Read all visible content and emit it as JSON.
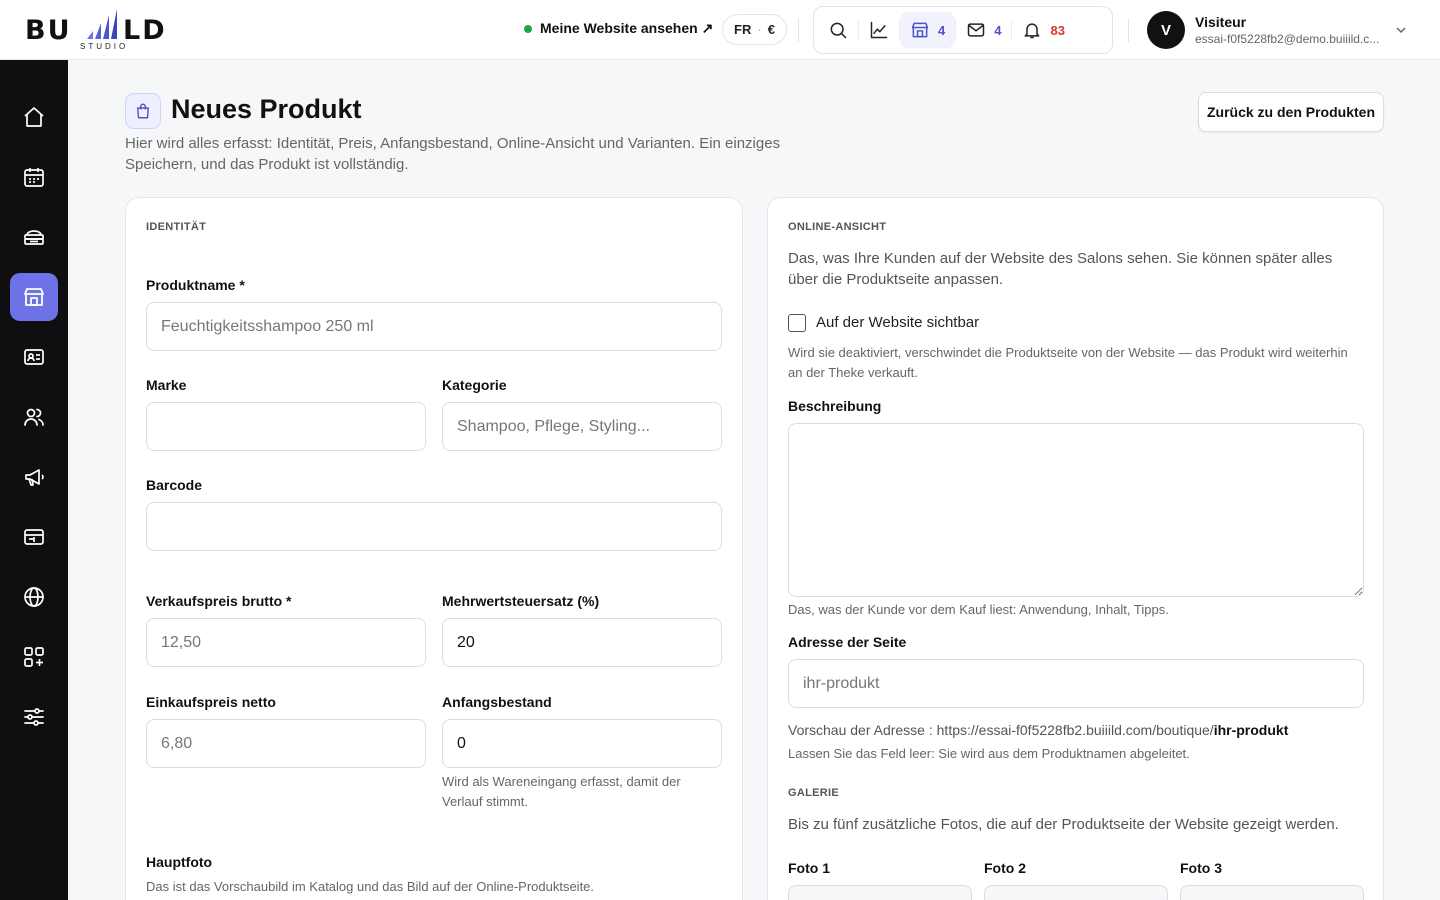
{
  "brand": {
    "logo_left": "BU",
    "logo_right": "LD",
    "logo_sub": "STUDIO"
  },
  "topbar": {
    "website_link": "Meine Website ansehen ↗",
    "lang": "FR",
    "currency": "€",
    "shop_count": "4",
    "mail_count": "4",
    "notif_count": "83",
    "accent": "#4b55c9",
    "notif_color": "#d63a2f"
  },
  "user": {
    "initial": "V",
    "name": "Visiteur",
    "email": "essai-f0f5228fb2@demo.buiiild.c..."
  },
  "sidebar": {
    "items": [
      "home-icon",
      "calendar-icon",
      "services-icon",
      "shop-icon",
      "contact-card-icon",
      "users-icon",
      "megaphone-icon",
      "register-icon",
      "globe-icon",
      "apps-icon",
      "sliders-icon"
    ],
    "active": "shop-icon",
    "active_color": "#6d73e6"
  },
  "page": {
    "title": "Neues Produkt",
    "description": "Hier wird alles erfasst: Identität, Preis, Anfangsbestand, Online-Ansicht und Varianten. Ein einziges Speichern, und das Produkt ist vollständig.",
    "back_button": "Zurück zu den Produkten"
  },
  "identity": {
    "section": "IDENTITÄT",
    "name_label": "Produktname *",
    "name_placeholder": "Feuchtigkeitsshampoo 250 ml",
    "brand_label": "Marke",
    "brand_placeholder": "",
    "category_label": "Kategorie",
    "category_placeholder": "Shampoo, Pflege, Styling...",
    "barcode_label": "Barcode",
    "barcode_placeholder": "",
    "price_label": "Verkaufspreis brutto *",
    "price_placeholder": "12,50",
    "vat_label": "Mehrwertsteuersatz (%)",
    "vat_value": "20",
    "cost_label": "Einkaufspreis netto",
    "cost_placeholder": "6,80",
    "stock_label": "Anfangsbestand",
    "stock_value": "0",
    "stock_hint": "Wird als Wareneingang erfasst, damit der Verlauf stimmt.",
    "photo_label": "Hauptfoto",
    "photo_hint": "Das ist das Vorschaubild im Katalog und das Bild auf der Online-Produktseite."
  },
  "online": {
    "section": "ONLINE-ANSICHT",
    "intro": "Das, was Ihre Kunden auf der Website des Salons sehen. Sie können später alles über die Produktseite anpassen.",
    "visible_label": "Auf der Website sichtbar",
    "visible_hint": "Wird sie deaktiviert, verschwindet die Produktseite von der Website — das Produkt wird weiterhin an der Theke verkauft.",
    "desc_label": "Beschreibung",
    "desc_hint": "Das, was der Kunde vor dem Kauf liest: Anwendung, Inhalt, Tipps.",
    "address_label": "Adresse der Seite",
    "address_placeholder": "ihr-produkt",
    "preview_prefix": "Vorschau der Adresse : https://essai-f0f5228fb2.buiiild.com/boutique/",
    "preview_slug": "ihr-produkt",
    "address_hint": "Lassen Sie das Feld leer: Sie wird aus dem Produktnamen abgeleitet.",
    "gallery_section": "GALERIE",
    "gallery_intro": "Bis zu fünf zusätzliche Fotos, die auf der Produktseite der Website gezeigt werden.",
    "photo1": "Foto 1",
    "photo2": "Foto 2",
    "photo3": "Foto 3"
  }
}
